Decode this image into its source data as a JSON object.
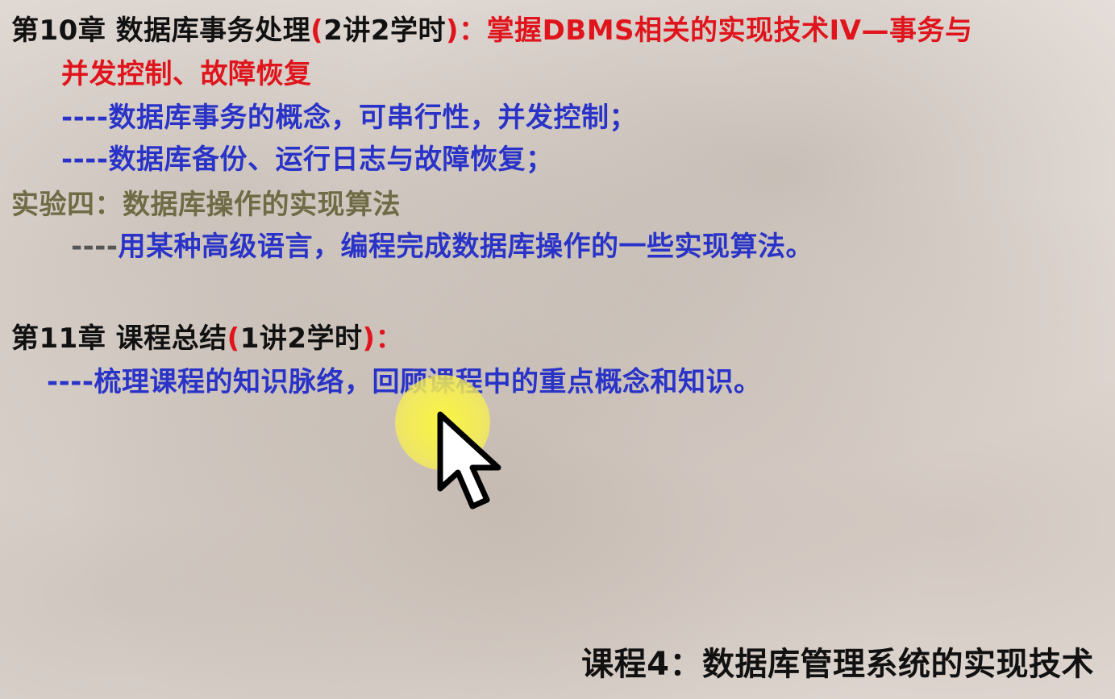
{
  "slide": {
    "chapter10": {
      "title_prefix": "第10章  数据库事务处理",
      "paren_open": "(",
      "hours": "2讲2学时",
      "paren_close": ")",
      "colon_goal": "：掌握DBMS相关的实现技术IV—事务与",
      "goal_continued": "并发控制、故障恢复",
      "points": [
        "----数据库事务的概念，可串行性，并发控制；",
        "----数据库备份、运行日志与故障恢复；"
      ]
    },
    "lab4": {
      "title": "实验四：数据库操作的实现算法",
      "dashes": "----",
      "description": "用某种高级语言，编程完成数据库操作的一些实现算法。"
    },
    "chapter11": {
      "title_prefix": "第11章  课程总结",
      "paren_open": "(",
      "hours": "1讲2学时",
      "paren_close": ")",
      "colon": "：",
      "point": "----梳理课程的知识脉络，回顾课程中的重点概念和知识。"
    },
    "footer": "课程4：数据库管理系统的实现技术"
  },
  "colors": {
    "heading": "#111111",
    "accent_red": "#e0141c",
    "body_blue": "#2a33c8",
    "lab_olive": "#6e6b45",
    "cursor_highlight": "#fcf83c"
  },
  "icons": {
    "cursor": "arrow-cursor-icon",
    "highlight": "cursor-highlight-circle"
  }
}
